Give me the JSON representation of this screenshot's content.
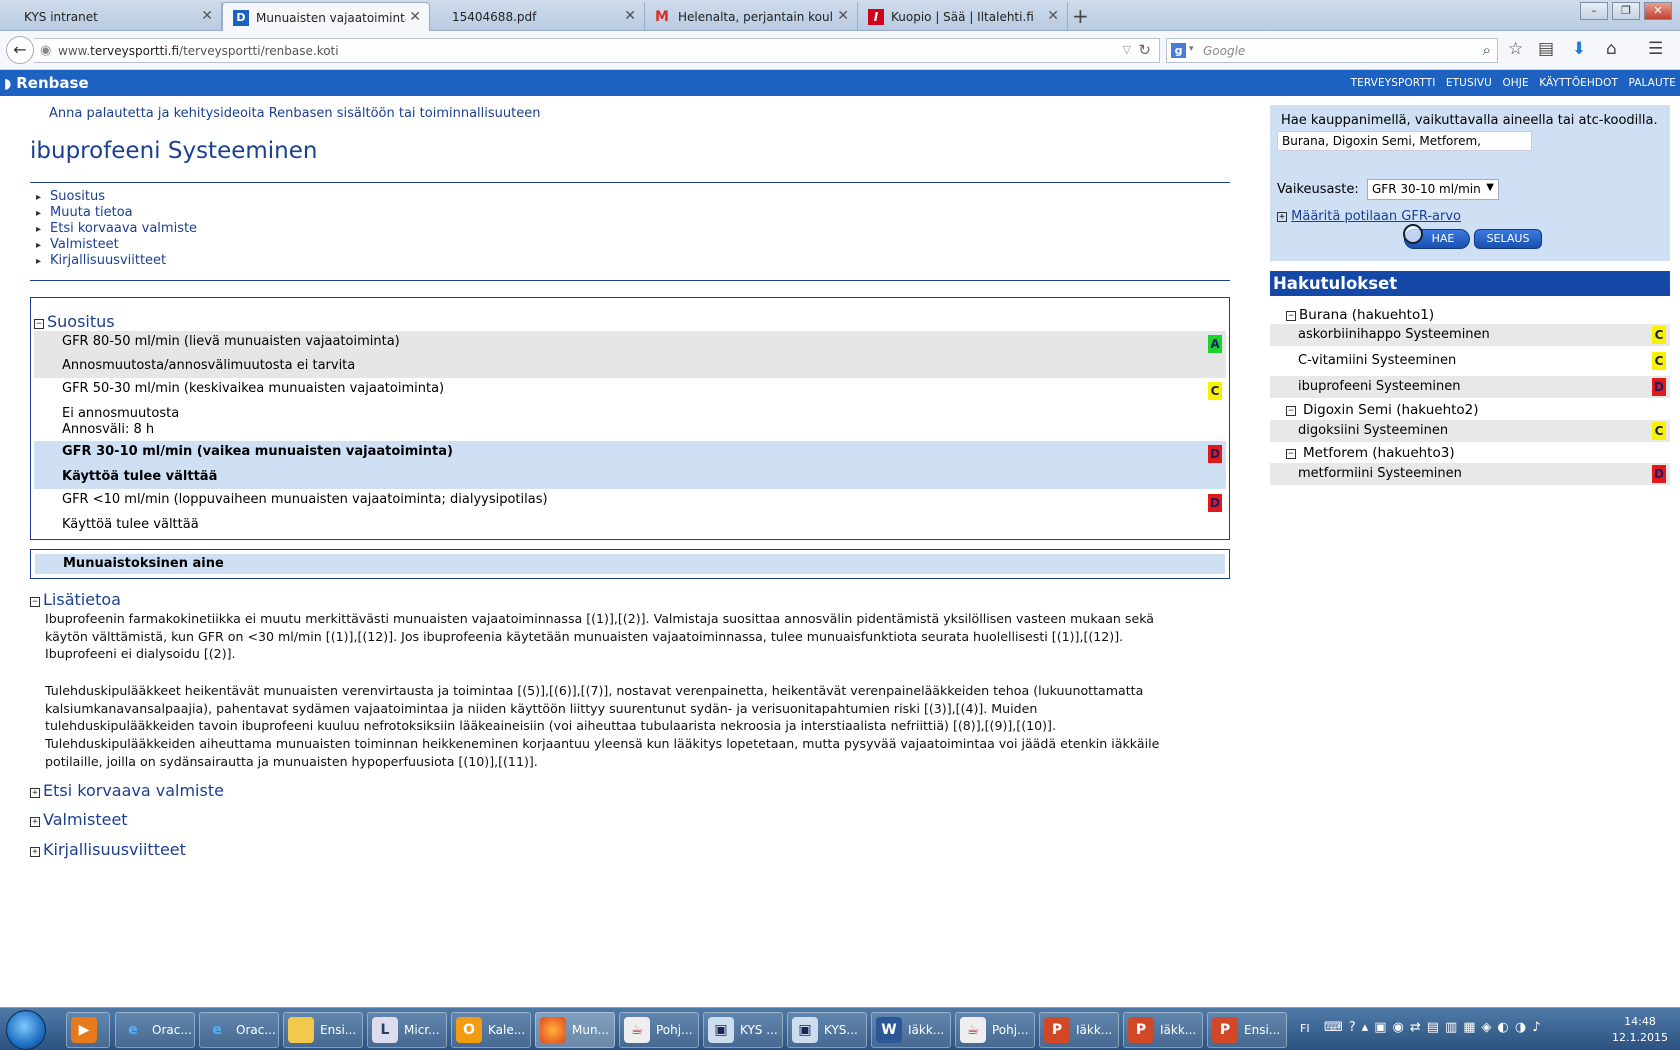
{
  "browser": {
    "tabs": [
      {
        "title": "KYS intranet",
        "active": false
      },
      {
        "title": "Munuaisten vajaatoiminta ...",
        "active": true
      },
      {
        "title": "15404688.pdf",
        "active": false
      },
      {
        "title": "Helenalta, perjantain koulu...",
        "active": false
      },
      {
        "title": "Kuopio | Sää | Iltalehti.fi",
        "active": false
      }
    ],
    "url_prefix": "www.",
    "url_domain": "terveysportti.fi",
    "url_path": "/terveysportti/renbase.koti",
    "search_placeholder": "Google"
  },
  "app": {
    "name": "Renbase",
    "nav": [
      "TERVEYSPORTTI",
      "ETUSIVU",
      "OHJE",
      "KÄYTTÖEHDOT",
      "PALAUTE"
    ]
  },
  "main": {
    "feedback_link": "Anna palautetta ja kehitysideoita Renbasen sisältöön tai toiminnallisuuteen",
    "title": "ibuprofeeni Systeeminen",
    "toc": [
      "Suositus",
      "Muuta tietoa",
      "Etsi korvaava valmiste",
      "Valmisteet",
      "Kirjallisuusviitteet"
    ],
    "recommendation": {
      "heading": "Suositus",
      "rows": [
        {
          "gfr": "GFR 80-50 ml/min (lievä munuaisten vajaatoiminta)",
          "advice": [
            "Annosmuutosta/annosvälimuutosta ei tarvita"
          ],
          "grade": "A",
          "grade_color": "#19d42a"
        },
        {
          "gfr": "GFR 50-30 ml/min (keskivaikea munuaisten vajaatoiminta)",
          "advice": [
            "Ei annosmuutosta",
            "Annosväli: 8 h"
          ],
          "grade": "C",
          "grade_color": "#f6f200"
        },
        {
          "gfr": "GFR 30-10 ml/min (vaikea munuaisten vajaatoiminta)",
          "advice": [
            "Käyttöä tulee välttää"
          ],
          "grade": "D",
          "grade_color": "#e01a1a"
        },
        {
          "gfr": "GFR <10 ml/min (loppuvaiheen munuaisten vajaatoiminta; dialyysipotilas)",
          "advice": [
            "Käyttöä tulee välttää"
          ],
          "grade": "D",
          "grade_color": "#e01a1a"
        }
      ]
    },
    "toxic_label": "Munuaistoksinen aine",
    "additional": {
      "heading": "Lisätietoa",
      "paragraph1_lines": [
        "Ibuprofeenin farmakokinetiikka ei muutu merkittävästi munuaisten vajaatoiminnassa [(1)],[(2)]. Valmistaja suosittaa annosvälin pidentämistä yksilöllisen vasteen mukaan sekä",
        "käytön välttämistä, kun GFR on <30 ml/min [(1)],[(12)]. Jos ibuprofeenia käytetään munuaisten vajaatoiminnassa, tulee munuaisfunktiota seurata huolellisesti [(1)],[(12)].",
        "Ibuprofeeni ei dialysoidu [(2)]."
      ],
      "paragraph2_lines": [
        "Tulehduskipulääkkeet heikentävät munuaisten verenvirtausta ja toimintaa [(5)],[(6)],[(7)], nostavat verenpainetta, heikentävät verenpainelääkkeiden tehoa (lukuunottamatta",
        "kalsiumkanavansalpaajia), pahentavat sydämen vajaatoimintaa ja niiden käyttöön liittyy suurentunut sydän- ja verisuonitapahtumien riski [(3)],[(4)]. Muiden",
        "tulehduskipulääkkeiden tavoin ibuprofeeni kuuluu nefrotoksiksiin lääkeaineisiin (voi aiheuttaa tubulaarista nekroosia ja interstiaalista nefriittiä) [(8)],[(9)],[(10)].",
        "Tulehduskipulääkkeiden aiheuttama munuaisten toiminnan heikkeneminen korjaantuu yleensä kun lääkitys lopetetaan, mutta pysyvää vajaatoimintaa voi jäädä etenkin iäkkäile",
        "potilaille, joilla on sydänsairautta ja munuaisten hypoperfuusiota [(10)],[(11)]."
      ]
    },
    "collapsed_sections": [
      "Etsi korvaava valmiste",
      "Valmisteet",
      "Kirjallisuusviitteet"
    ]
  },
  "search_panel": {
    "hint": "Hae kauppanimellä, vaikuttavalla aineella tai atc-koodilla.",
    "input_value": "Burana, Digoxin Semi, Metforem,",
    "severity_label": "Vaikeusaste:",
    "severity_value": "GFR 30-10 ml/min",
    "gfr_link": "Määritä potilaan GFR-arvo",
    "search_button": "HAE",
    "browse_button": "SELAUS"
  },
  "results": {
    "heading": "Hakutulokset",
    "groups": [
      {
        "name": "Burana (hakuehto1)",
        "items": [
          {
            "label": "askorbiinihappo Systeeminen",
            "grade": "C"
          },
          {
            "label": "C-vitamiini Systeeminen",
            "grade": "C"
          },
          {
            "label": "ibuprofeeni Systeeminen",
            "grade": "D"
          }
        ]
      },
      {
        "name": "Digoxin Semi (hakuehto2)",
        "items": [
          {
            "label": "digoksiini Systeeminen",
            "grade": "C"
          }
        ]
      },
      {
        "name": "Metforem (hakuehto3)",
        "items": [
          {
            "label": "metformiini Systeeminen",
            "grade": "D"
          }
        ]
      }
    ]
  },
  "taskbar": {
    "items": [
      "Orac...",
      "Orac...",
      "Ensi...",
      "Micr...",
      "Kale...",
      "Mun...",
      "Pohj...",
      "KYS ...",
      "KYS...",
      "Iäkk...",
      "Pohj...",
      "Iäkk...",
      "Iäkk...",
      "Ensi..."
    ],
    "lang": "FI",
    "time": "14:48",
    "date": "12.1.2015"
  }
}
